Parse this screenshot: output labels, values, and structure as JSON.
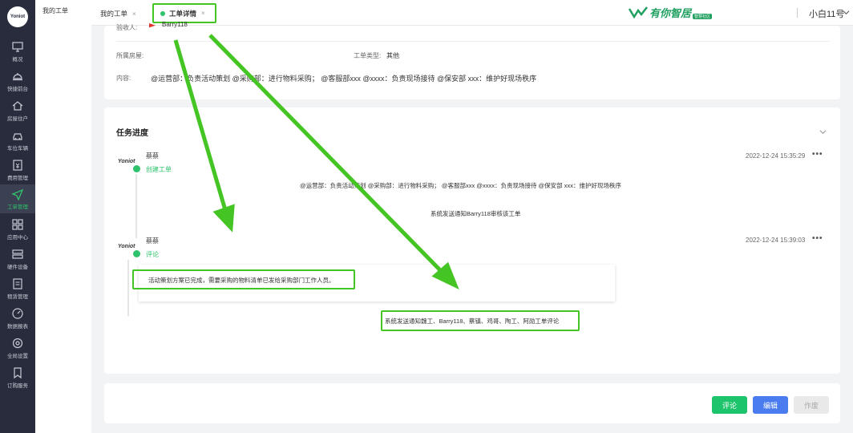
{
  "sidebar": {
    "logo": "Yoniot",
    "items": [
      {
        "label": "概况",
        "icon": "monitor-icon"
      },
      {
        "label": "快捷前台",
        "icon": "service-bell-icon"
      },
      {
        "label": "房屋住户",
        "icon": "house-icon"
      },
      {
        "label": "车位车辆",
        "icon": "car-icon"
      },
      {
        "label": "费用管理",
        "icon": "fee-icon"
      },
      {
        "label": "工单管理",
        "icon": "send-icon",
        "active": true
      },
      {
        "label": "应用中心",
        "icon": "grid-icon"
      },
      {
        "label": "硬件设备",
        "icon": "device-icon"
      },
      {
        "label": "租赁管理",
        "icon": "document-icon"
      },
      {
        "label": "数据报表",
        "icon": "gauge-icon"
      },
      {
        "label": "全局设置",
        "icon": "gear-icon"
      },
      {
        "label": "订购服务",
        "icon": "bookmark-icon"
      }
    ]
  },
  "submenu": {
    "item": "我的工单"
  },
  "topbar": {
    "tabs": [
      {
        "label": "我的工单",
        "close": "×"
      },
      {
        "label": "工单详情",
        "close": "×",
        "active": true
      }
    ],
    "brand": "有你智居",
    "brand_badge": "智慧社区",
    "user": "小白11号"
  },
  "info": {
    "acceptor_label": "验收人:",
    "acceptor_value": "Barry118",
    "house_label": "所属房屋:",
    "type_label": "工单类型:",
    "type_value": "其他",
    "content_label": "内容:",
    "content_value": "@运营部：负责活动策划 @采购部：进行物料采购； @客服部xxx @xxxx：负责现场接待 @保安部 xxx：维护好现场秩序"
  },
  "progress": {
    "title": "任务进度",
    "entries": [
      {
        "logo": "Yoniot",
        "author": "蔡蔡",
        "action": "创建工单",
        "time": "2022-12-24 15:35:29",
        "more": "•••",
        "content": "@运营部：负责活动策划 @采购部：进行物料采购； @客服部xxx @xxxx：负责现场接待 @保安部 xxx：维护好现场秩序",
        "notice": "系统发送通知Barry118审核该工单"
      },
      {
        "logo": "Yoniot",
        "author": "蔡蔡",
        "action": "评论",
        "time": "2022-12-24 15:39:03",
        "more": "•••",
        "content": "活动策划方案已完成，需要采购的物料清单已发给采购部门工作人员。",
        "notice": "系统发送通知魏工、Barry118、蔡镇、鸡哥、陶工、阿勋工单评论"
      }
    ]
  },
  "actions": {
    "comment": "评论",
    "edit": "编辑",
    "void": "作废"
  },
  "colors": {
    "primary_green": "#2ec26c",
    "annotation_green": "#44c524",
    "edit_blue": "#4a7cf0",
    "sidebar_bg": "#282c3c"
  }
}
